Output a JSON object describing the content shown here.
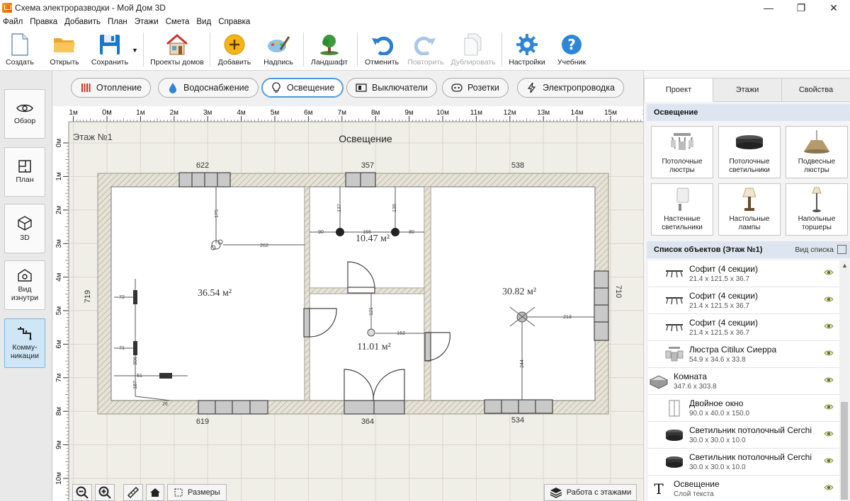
{
  "window": {
    "title": "Схема электроразводки - Мой Дом 3D",
    "minimize": "—",
    "maximize": "❐",
    "close": "✕"
  },
  "menu": [
    "Файл",
    "Правка",
    "Добавить",
    "План",
    "Этажи",
    "Смета",
    "Вид",
    "Справка"
  ],
  "toolbar": {
    "create": "Создать",
    "open": "Открыть",
    "save": "Сохранить",
    "projects": "Проекты домов",
    "add": "Добавить",
    "label": "Надпись",
    "landscape": "Ландшафт",
    "undo": "Отменить",
    "redo": "Повторить",
    "duplicate": "Дублировать",
    "settings": "Настройки",
    "tutorial": "Учебник"
  },
  "sidebar": {
    "overview": "Обзор",
    "plan": "План",
    "view3d": "3D",
    "inside": "Вид\nизнутри",
    "comms": "Комму-\nникации"
  },
  "categories": {
    "heating": "Отопление",
    "water": "Водоснабжение",
    "lighting": "Освещение",
    "switches": "Выключатели",
    "sockets": "Розетки",
    "wiring": "Электропроводка"
  },
  "plan": {
    "floor_label": "Этаж №1",
    "layer_title": "Освещение",
    "ruler_x": [
      "1м",
      "0м",
      "1м",
      "2м",
      "3м",
      "4м",
      "5м",
      "6м",
      "7м",
      "8м",
      "9м",
      "10м",
      "11м",
      "12м",
      "13м",
      "14м",
      "15м",
      "1"
    ],
    "ruler_y": [
      "0м",
      "1м",
      "2м",
      "3м",
      "4м",
      "5м",
      "6м",
      "7м",
      "8м",
      "9м",
      "10м"
    ],
    "dims": {
      "top_left": "622",
      "top_mid": "357",
      "top_right": "538",
      "bottom_left": "619",
      "bottom_mid": "364",
      "bottom_right": "534",
      "left": "719",
      "right": "710"
    },
    "areas": {
      "room1": "36.54 м²",
      "room2": "10.47 м²",
      "room3": "11.01 м²",
      "room4": "30.82 м²"
    },
    "small": {
      "r1_v": "175",
      "r1_h": "262",
      "r2_l": "90",
      "r2_mid": "166",
      "r2_r": "80",
      "r2_v1": "137",
      "r2_v2": "136",
      "r3_v": "121",
      "r3_h": "163",
      "r4_h": "213",
      "r4_v": "244",
      "sw1": "72",
      "sw2": "71",
      "sw3": "306",
      "sw4": "187",
      "sw5": "51",
      "sw6": "26"
    }
  },
  "bottom": {
    "dimensions": "Размеры",
    "floors": "Работа с этажами"
  },
  "right": {
    "tabs": [
      "Проект",
      "Этажи",
      "Свойства"
    ],
    "section": "Освещение",
    "cards": [
      "Потолочные\nлюстры",
      "Потолочные\nсветильники",
      "Подвесные\nлюстры",
      "Настенные\nсветильники",
      "Настольные\nлампы",
      "Напольные\nторшеры"
    ],
    "list_title": "Список объектов (Этаж №1)",
    "list_view": "Вид списка",
    "objects": [
      {
        "name": "Софит (4 секции)",
        "dims": "21.4 x 121.5 x 36.7",
        "icon": "spotlight-icon"
      },
      {
        "name": "Софит (4 секции)",
        "dims": "21.4 x 121.5 x 36.7",
        "icon": "spotlight-icon"
      },
      {
        "name": "Софит (4 секции)",
        "dims": "21.4 x 121.5 x 36.7",
        "icon": "spotlight-icon"
      },
      {
        "name": "Люстра Citilux Сиерра",
        "dims": "54.9 x 34.6 x 33.8",
        "icon": "chandelier-icon"
      },
      {
        "name": "Комната",
        "dims": "347.6 x 303.8",
        "icon": "room-icon"
      },
      {
        "name": "Двойное окно",
        "dims": "90.0 x 40.0 x 150.0",
        "icon": "window-icon"
      },
      {
        "name": "Светильник потолочный Cerchi",
        "dims": "30.0 x 30.0 x 10.0",
        "icon": "ceiling-lamp-icon"
      },
      {
        "name": "Светильник потолочный Cerchi",
        "dims": "30.0 x 30.0 x 10.0",
        "icon": "ceiling-lamp-icon"
      },
      {
        "name": "Освещение",
        "dims": "Слой текста",
        "icon": "text-layer-icon"
      }
    ]
  }
}
